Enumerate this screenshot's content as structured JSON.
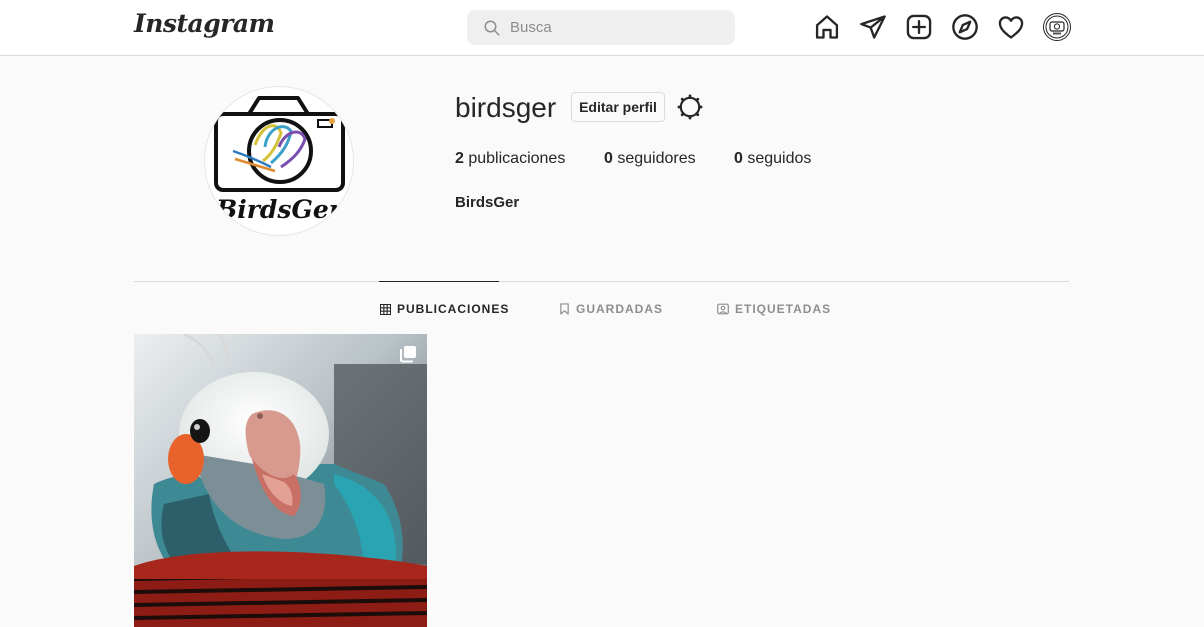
{
  "header": {
    "logo": "Instagram",
    "search": {
      "placeholder": "Busca"
    },
    "nav_icons": [
      "home-icon",
      "send-icon",
      "new-post-icon",
      "explore-icon",
      "heart-icon",
      "avatar"
    ]
  },
  "profile": {
    "username": "birdsger",
    "edit_button": "Editar perfil",
    "settings_icon": "gear-icon",
    "stats": {
      "posts_count": "2",
      "posts_label": "publicaciones",
      "followers_count": "0",
      "followers_label": "seguidores",
      "following_count": "0",
      "following_label": "seguidos"
    },
    "full_name": "BirdsGer",
    "avatar_text": "BirdsGer"
  },
  "tabs": [
    {
      "label": "PUBLICACIONES",
      "icon": "grid-icon",
      "active": true
    },
    {
      "label": "GUARDADAS",
      "icon": "bookmark-icon",
      "active": false
    },
    {
      "label": "ETIQUETADAS",
      "icon": "tagged-icon",
      "active": false
    }
  ],
  "posts": [
    {
      "subject": "cockatiel chick",
      "multi_image": true
    }
  ],
  "colors": {
    "text": "#262626",
    "muted": "#8e8e8e",
    "border": "#dbdbdb",
    "background": "#fafafa"
  }
}
